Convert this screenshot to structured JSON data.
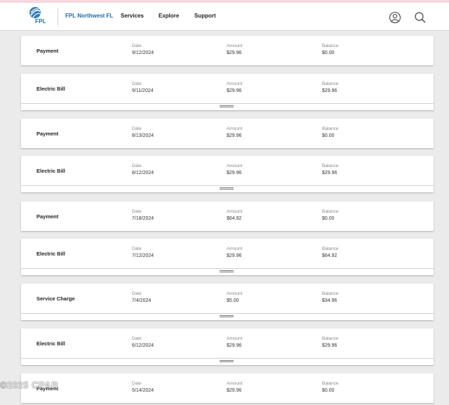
{
  "header": {
    "logo_text": "FPL",
    "brand": "FPL Northwest FL",
    "nav": [
      "Services",
      "Explore",
      "Support"
    ],
    "account_icon": "user-circle-icon",
    "search_icon": "search-icon"
  },
  "columns": {
    "date": "Date",
    "amount": "Amount",
    "balance": "Balance"
  },
  "transactions": [
    {
      "type": "Payment",
      "date": "9/12/2024",
      "amount": "$29.96",
      "balance": "$0.00",
      "expandable": false
    },
    {
      "type": "Electric Bill",
      "date": "9/11/2024",
      "amount": "$29.96",
      "balance": "$29.96",
      "expandable": true
    },
    {
      "type": "Payment",
      "date": "8/13/2024",
      "amount": "$29.96",
      "balance": "$0.00",
      "expandable": false
    },
    {
      "type": "Electric Bill",
      "date": "8/12/2024",
      "amount": "$29.96",
      "balance": "$29.96",
      "expandable": true
    },
    {
      "type": "Payment",
      "date": "7/18/2024",
      "amount": "$64.92",
      "balance": "$0.00",
      "expandable": false
    },
    {
      "type": "Electric Bill",
      "date": "7/12/2024",
      "amount": "$29.96",
      "balance": "$64.92",
      "expandable": true
    },
    {
      "type": "Service Charge",
      "date": "7/4/2024",
      "amount": "$5.00",
      "balance": "$34.96",
      "expandable": true
    },
    {
      "type": "Electric Bill",
      "date": "6/12/2024",
      "amount": "$29.96",
      "balance": "$29.96",
      "expandable": true
    },
    {
      "type": "Payment",
      "date": "5/14/2024",
      "amount": "$29.96",
      "balance": "$0.00",
      "expandable": false
    }
  ],
  "watermark": "©2025 CPAR"
}
